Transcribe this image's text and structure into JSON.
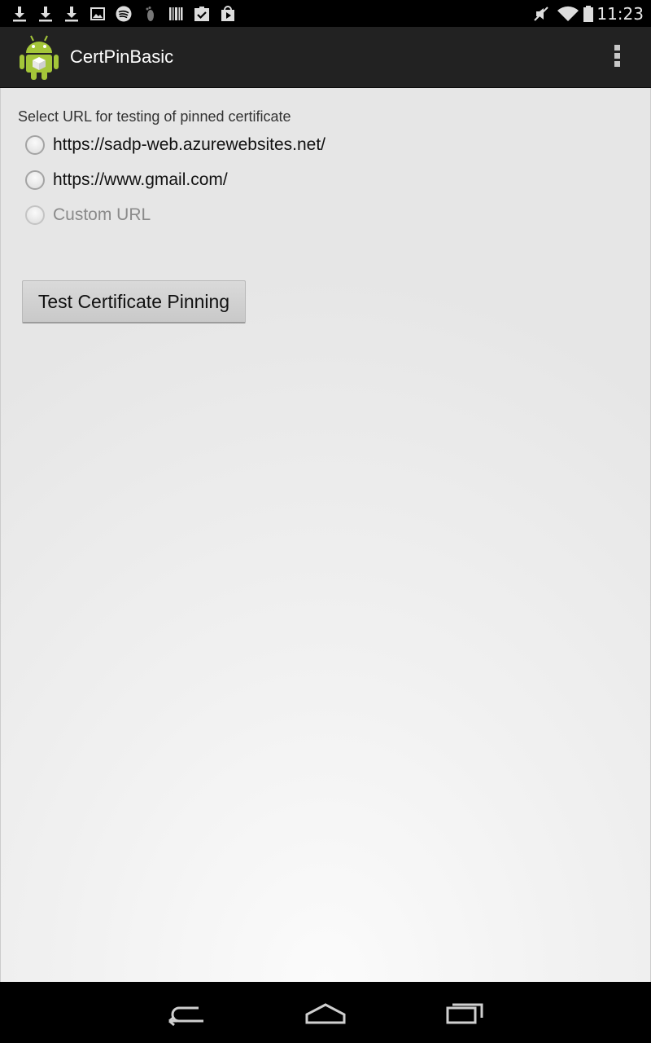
{
  "status_bar": {
    "time": "11:23",
    "left_icons": [
      "download-icon",
      "download-icon",
      "download-icon",
      "image-icon",
      "spotify-icon",
      "foot-icon",
      "barcode-icon",
      "clipboard-check-icon",
      "play-store-icon"
    ],
    "right_icons": [
      "mute-icon",
      "wifi-icon",
      "battery-icon"
    ]
  },
  "action_bar": {
    "title": "CertPinBasic",
    "app_icon": "android-icon",
    "menu_icon": "overflow-menu-icon"
  },
  "main": {
    "prompt": "Select URL for testing of pinned certificate",
    "options": [
      {
        "label": "https://sadp-web.azurewebsites.net/",
        "checked": false,
        "enabled": true
      },
      {
        "label": "https://www.gmail.com/",
        "checked": false,
        "enabled": true
      },
      {
        "label": "Custom URL",
        "checked": false,
        "enabled": false
      }
    ],
    "button_label": "Test Certificate Pinning"
  },
  "nav_bar": {
    "buttons": [
      "back-icon",
      "home-icon",
      "recents-icon"
    ]
  },
  "colors": {
    "action_bar_bg": "#222222",
    "status_bar_bg": "#000000",
    "android_green": "#a4c639"
  }
}
